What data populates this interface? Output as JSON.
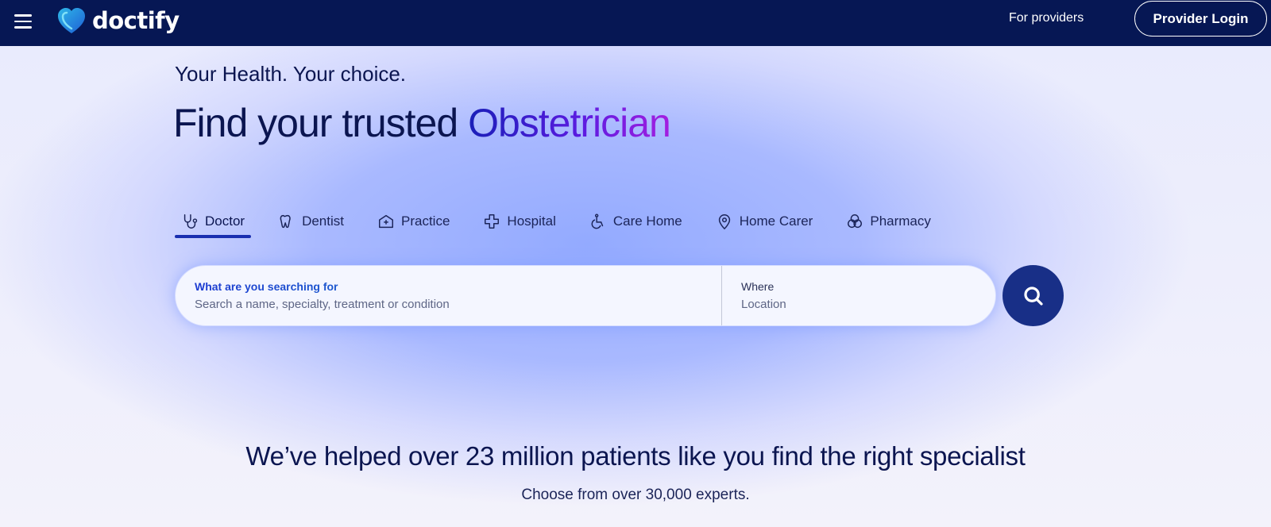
{
  "header": {
    "logo_text": "doctify",
    "for_providers": "For providers",
    "provider_login": "Provider Login"
  },
  "hero": {
    "tagline": "Your Health. Your choice.",
    "headline_prefix": "Find your trusted ",
    "headline_accent": "Obstetrician"
  },
  "tabs": [
    {
      "label": "Doctor",
      "icon": "stethoscope-icon",
      "active": true
    },
    {
      "label": "Dentist",
      "icon": "tooth-icon"
    },
    {
      "label": "Practice",
      "icon": "clinic-icon"
    },
    {
      "label": "Hospital",
      "icon": "hospital-icon"
    },
    {
      "label": "Care Home",
      "icon": "wheelchair-icon"
    },
    {
      "label": "Home Carer",
      "icon": "location-pin-icon"
    },
    {
      "label": "Pharmacy",
      "icon": "pills-icon"
    }
  ],
  "search": {
    "what_label": "What are you searching for",
    "what_placeholder": "Search a name, specialty, treatment or condition",
    "where_label": "Where",
    "where_placeholder": "Location"
  },
  "stats": {
    "title": "We’ve helped over 23 million patients like you find the right specialist",
    "subtitle": "Choose from over 30,000 experts."
  },
  "colors": {
    "header_bg": "#061754",
    "search_button": "#182f87",
    "accent_start": "#1a1fb8",
    "accent_end": "#a41fe0"
  }
}
